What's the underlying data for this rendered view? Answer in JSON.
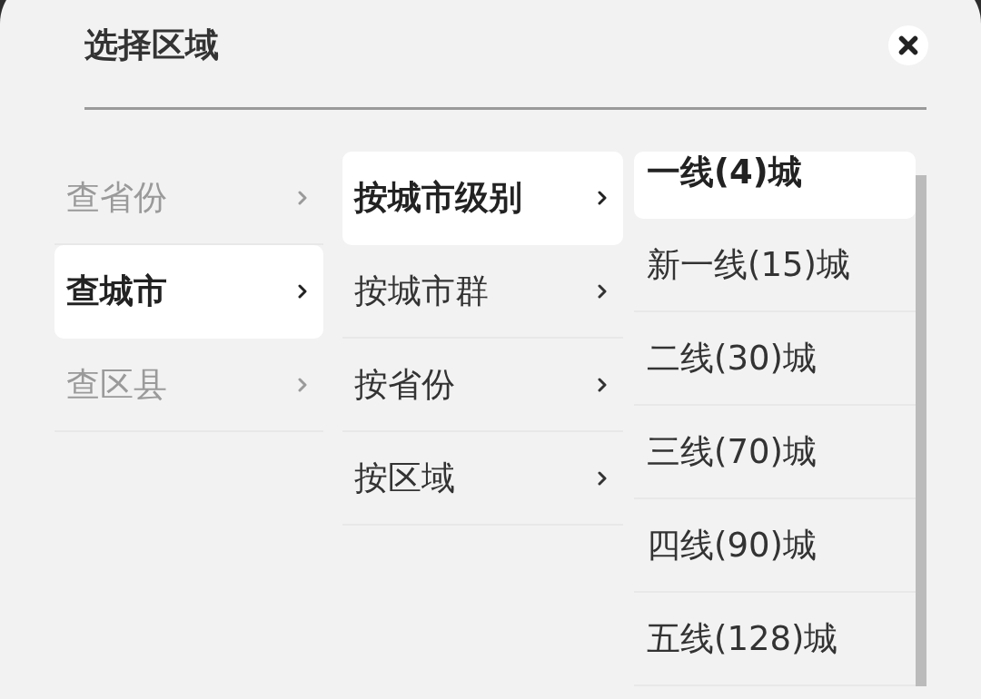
{
  "sheet": {
    "title": "选择区域"
  },
  "columns": [
    {
      "kind": "category",
      "items": [
        {
          "label": "查省份",
          "selected": false
        },
        {
          "label": "查城市",
          "selected": true
        },
        {
          "label": "查区县",
          "selected": false
        }
      ]
    },
    {
      "kind": "submenu",
      "items": [
        {
          "label": "按城市级别",
          "selected": true
        },
        {
          "label": "按城市群",
          "selected": false
        },
        {
          "label": "按省份",
          "selected": false
        },
        {
          "label": "按区域",
          "selected": false
        }
      ]
    },
    {
      "kind": "options",
      "items": [
        {
          "label": "一线(4)城",
          "selected": true
        },
        {
          "label": "新一线(15)城",
          "selected": false
        },
        {
          "label": "二线(30)城",
          "selected": false
        },
        {
          "label": "三线(70)城",
          "selected": false
        },
        {
          "label": "四线(90)城",
          "selected": false
        },
        {
          "label": "五线(128)城",
          "selected": false
        }
      ]
    }
  ]
}
